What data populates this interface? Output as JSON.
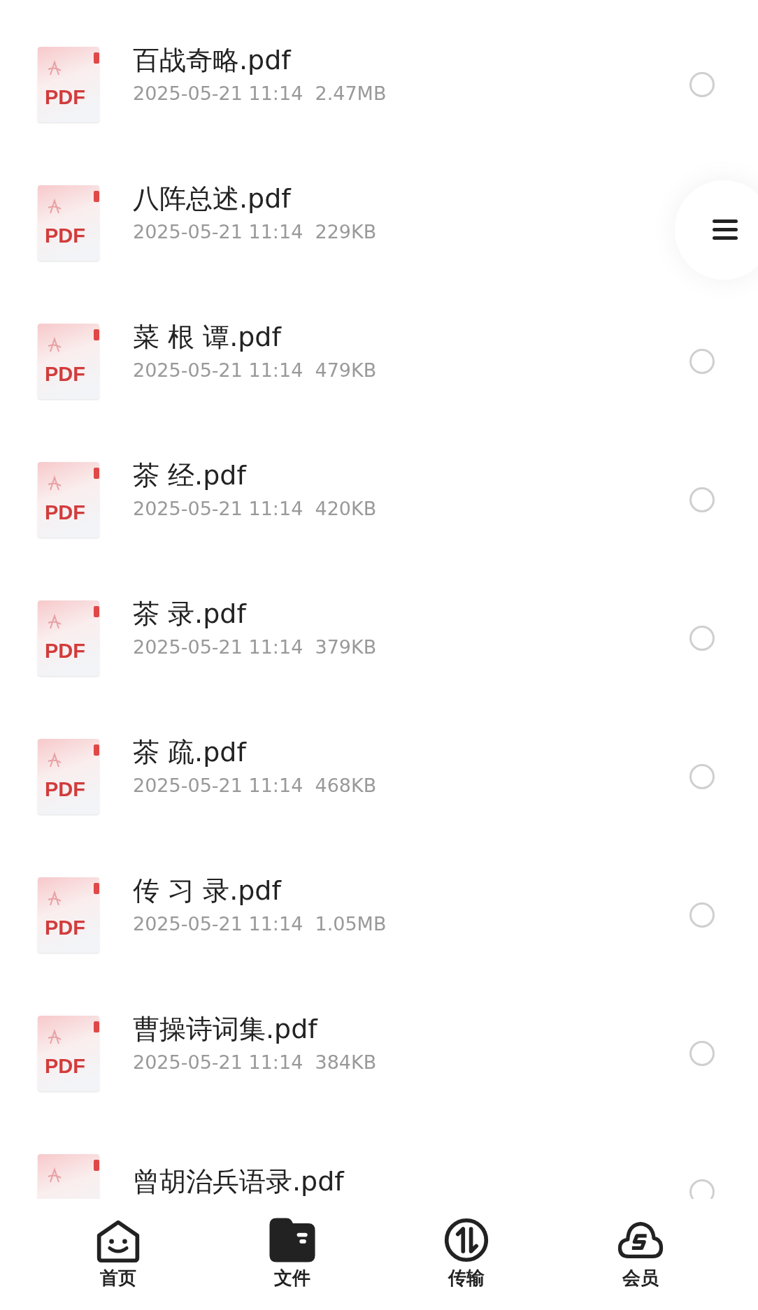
{
  "files": [
    {
      "badge": "PDF",
      "name": "百战奇略.pdf",
      "meta": "2025-05-21 11:14  2.47MB",
      "selected": false
    },
    {
      "badge": "PDF",
      "name": "八阵总述.pdf",
      "meta": "2025-05-21 11:14  229KB"
    },
    {
      "badge": "PDF",
      "name": "菜 根 谭.pdf",
      "meta": "2025-05-21 11:14  479KB",
      "selected": false
    },
    {
      "badge": "PDF",
      "name": "茶 经.pdf",
      "meta": "2025-05-21 11:14  420KB",
      "selected": false
    },
    {
      "badge": "PDF",
      "name": "茶 录.pdf",
      "meta": "2025-05-21 11:14  379KB",
      "selected": false
    },
    {
      "badge": "PDF",
      "name": "茶 疏.pdf",
      "meta": "2025-05-21 11:14  468KB",
      "selected": false
    },
    {
      "badge": "PDF",
      "name": "传 习 录.pdf",
      "meta": "2025-05-21 11:14  1.05MB",
      "selected": false
    },
    {
      "badge": "PDF",
      "name": "曹操诗词集.pdf",
      "meta": "2025-05-21 11:14  384KB",
      "selected": false
    },
    {
      "name": "曾胡治兵语录.pdf",
      "selected": false
    }
  ],
  "tabs": [
    {
      "kind": "home",
      "label": "首页",
      "selected": false
    },
    {
      "kind": "files",
      "label": "文件",
      "selected": true
    },
    {
      "kind": "transfer",
      "label": "传输",
      "selected": false
    },
    {
      "kind": "vip",
      "label": "会员",
      "selected": false
    }
  ]
}
